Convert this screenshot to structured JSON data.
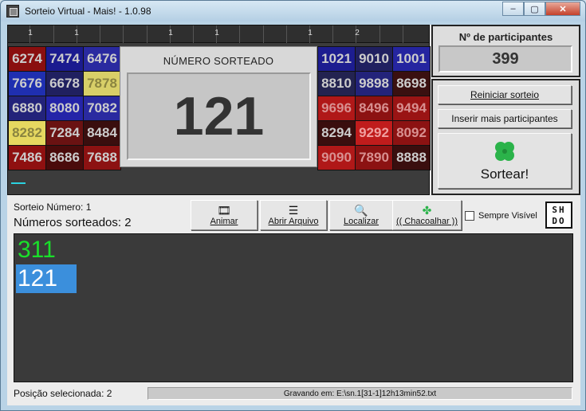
{
  "window": {
    "title": "Sorteio Virtual - Mais! - 1.0.98",
    "minimize_label": "–",
    "maximize_label": "▢",
    "close_label": "✕"
  },
  "ruler": {
    "labels": [
      "1",
      "1",
      "1",
      "1",
      "1",
      "2"
    ]
  },
  "left_grid": {
    "cells": [
      {
        "n": "6274",
        "bg": "#8a0f0f"
      },
      {
        "n": "7474",
        "bg": "#1b1b8f"
      },
      {
        "n": "6476",
        "bg": "#2a2aa0"
      },
      {
        "n": "7676",
        "bg": "#1f2fb0"
      },
      {
        "n": "6678",
        "bg": "#202060"
      },
      {
        "n": "7878",
        "bg": "#d8cf68",
        "fg": "#8a8440"
      },
      {
        "n": "6880",
        "bg": "#23237a"
      },
      {
        "n": "8080",
        "bg": "#2424a8"
      },
      {
        "n": "7082",
        "bg": "#2a2aa0"
      },
      {
        "n": "8282",
        "bg": "#e6d860",
        "fg": "#8a8440"
      },
      {
        "n": "7284",
        "bg": "#6a1212"
      },
      {
        "n": "8484",
        "bg": "#3a0e0e"
      },
      {
        "n": "7486",
        "bg": "#8f1010"
      },
      {
        "n": "8686",
        "bg": "#4a0b0b"
      },
      {
        "n": "7688",
        "bg": "#8c1212"
      }
    ]
  },
  "right_grid": {
    "cells": [
      {
        "n": "1021",
        "bg": "#1d1d90"
      },
      {
        "n": "9010",
        "bg": "#202060"
      },
      {
        "n": "1001",
        "bg": "#2525a0"
      },
      {
        "n": "8810",
        "bg": "#232350"
      },
      {
        "n": "9898",
        "bg": "#23237a"
      },
      {
        "n": "8698",
        "bg": "#3a1010"
      },
      {
        "n": "9696",
        "bg": "#b01818",
        "fg": "#d89090"
      },
      {
        "n": "8496",
        "bg": "#8c1212",
        "fg": "#d89090"
      },
      {
        "n": "9494",
        "bg": "#9a1414",
        "fg": "#d89090"
      },
      {
        "n": "8294",
        "bg": "#3a0e0e"
      },
      {
        "n": "9292",
        "bg": "#c01c1c",
        "fg": "#f0a0a0"
      },
      {
        "n": "8092",
        "bg": "#8c1212",
        "fg": "#d89090"
      },
      {
        "n": "9090",
        "bg": "#b01818",
        "fg": "#d89090"
      },
      {
        "n": "7890",
        "bg": "#8c1212",
        "fg": "#d89090"
      },
      {
        "n": "8888",
        "bg": "#3a0e0e"
      }
    ]
  },
  "center": {
    "title": "NÚMERO SORTEADO",
    "number": "121"
  },
  "participants": {
    "title": "Nº de participantes",
    "count": "399"
  },
  "actions": {
    "reset_label": "Reiniciar sorteio",
    "insert_label": "Inserir mais participantes",
    "draw_label": "Sortear!",
    "clover_icon": "four-leaf-clover-icon",
    "clover_color": "#2bb34a"
  },
  "info": {
    "draw_number": "Sorteio Número: 1",
    "drawn_count": "Números sorteados: 2"
  },
  "toolbar": {
    "animate_label": "Animar",
    "open_file_label": "Abrir Arquivo",
    "find_label": "Localizar",
    "shake_label": "(( Chacoalhar ))",
    "always_visible_label": "Sempre Visível",
    "logo_text_top": "SH",
    "logo_text_bottom": "DO"
  },
  "drawn_list": [
    {
      "value": "311",
      "color": "#19e02a",
      "selected": false
    },
    {
      "value": "121",
      "color": "#ffffff",
      "selected": true,
      "bg": "#3b8fdc"
    }
  ],
  "status": {
    "selected_position": "Posição selecionada: 2",
    "saving": "Gravando em: E:\\sn.1[31-1]12h13min52.txt"
  }
}
